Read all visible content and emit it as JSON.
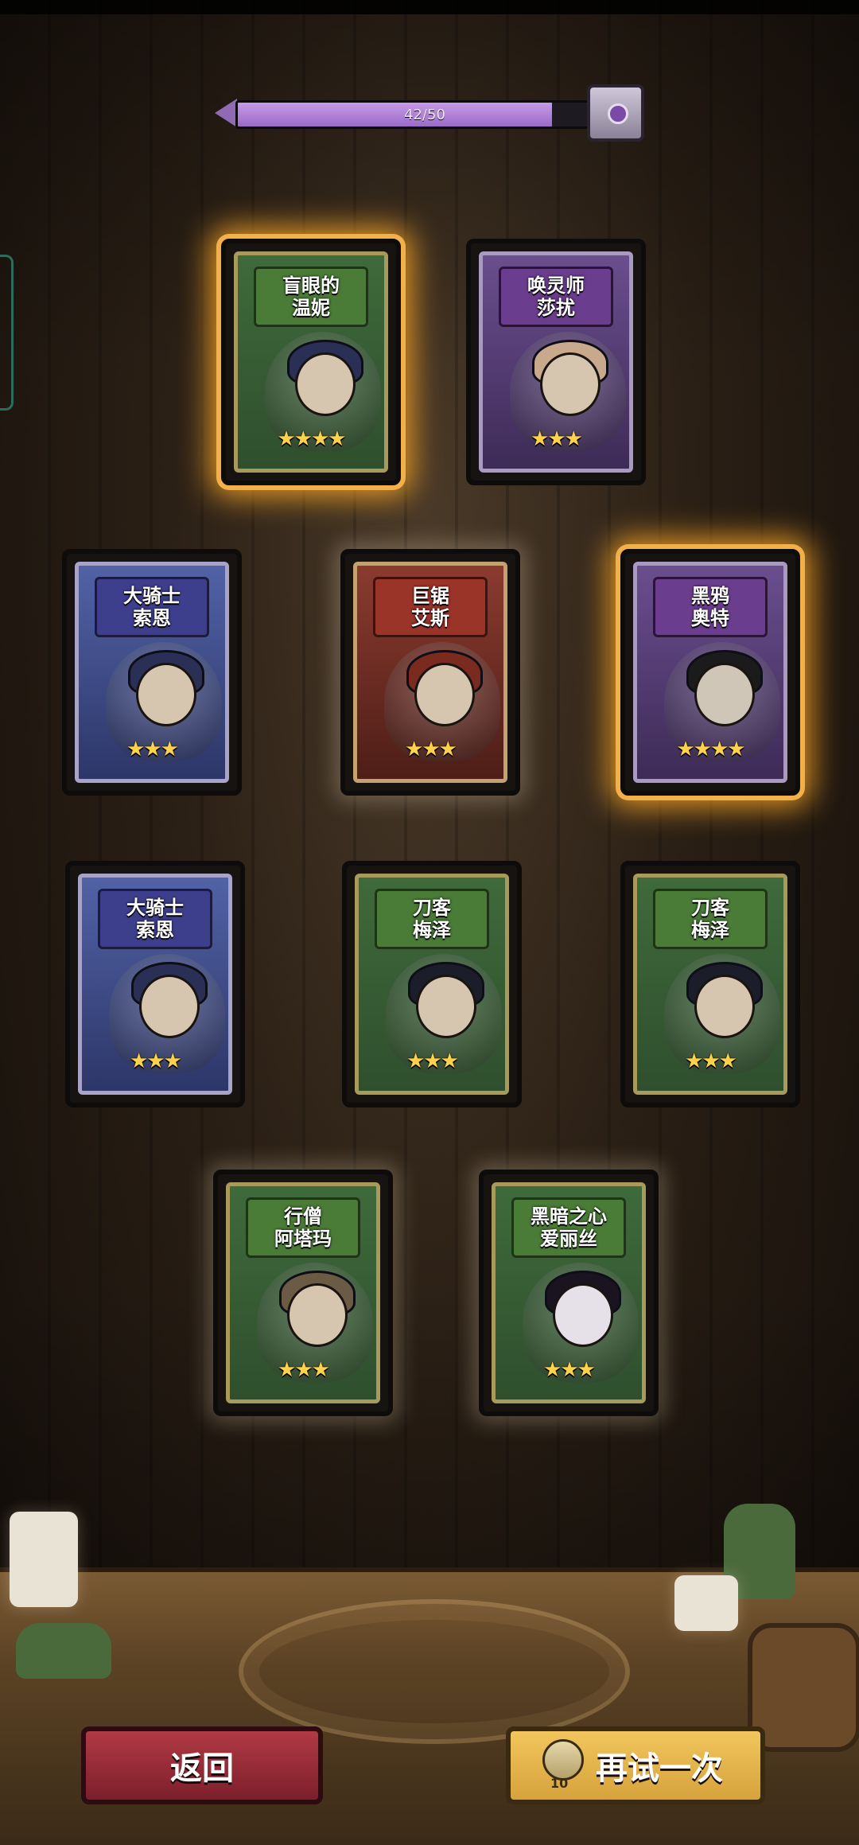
{
  "progress": {
    "label": "42/50",
    "current": 42,
    "max": 50,
    "icon": "treasure-chest-icon"
  },
  "cards": [
    {
      "name_line1": "盲眼的",
      "name_line2": "温妮",
      "stars": "★★★★",
      "color": "green",
      "glow": "gold"
    },
    {
      "name_line1": "唤灵师",
      "name_line2": "莎扰",
      "stars": "★★★",
      "color": "purple",
      "glow": "none"
    },
    {
      "name_line1": "大骑士",
      "name_line2": "索恩",
      "stars": "★★★",
      "color": "blue",
      "glow": "none"
    },
    {
      "name_line1": "巨锯",
      "name_line2": "艾斯",
      "stars": "★★★",
      "color": "red",
      "glow": "soft"
    },
    {
      "name_line1": "黑鸦",
      "name_line2": "奥特",
      "stars": "★★★★",
      "color": "purple",
      "glow": "gold"
    },
    {
      "name_line1": "大骑士",
      "name_line2": "索恩",
      "stars": "★★★",
      "color": "blue",
      "glow": "none"
    },
    {
      "name_line1": "刀客",
      "name_line2": "梅泽",
      "stars": "★★★",
      "color": "green",
      "glow": "none"
    },
    {
      "name_line1": "刀客",
      "name_line2": "梅泽",
      "stars": "★★★",
      "color": "green",
      "glow": "none"
    },
    {
      "name_line1": "行僧",
      "name_line2": "阿塔玛",
      "stars": "★★★",
      "color": "green",
      "glow": "soft"
    },
    {
      "name_line1": "黑暗之心",
      "name_line2": "爱丽丝",
      "stars": "★★★",
      "color": "green",
      "glow": "soft"
    }
  ],
  "buttons": {
    "back_label": "返回",
    "retry_label": "再试一次",
    "retry_cost": "10",
    "retry_cost_icon": "summon-token-icon"
  }
}
